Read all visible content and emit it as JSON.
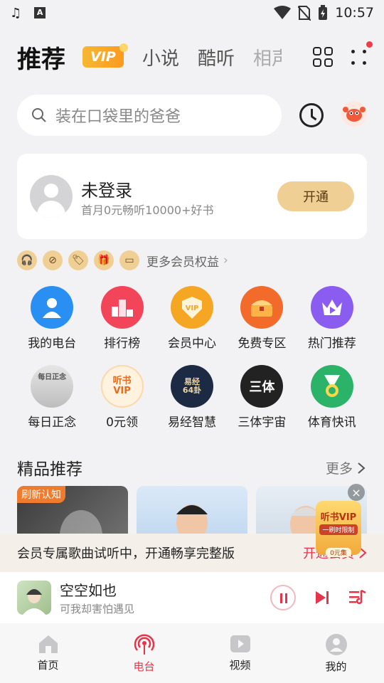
{
  "status_bar": {
    "time": "10:57"
  },
  "top_tabs": {
    "main": "推荐",
    "vip": "VIP",
    "tabs": [
      "小说",
      "酷听",
      "相声"
    ]
  },
  "search": {
    "placeholder": "装在口袋里的爸爸"
  },
  "login_card": {
    "title": "未登录",
    "subtitle": "首月0元畅听10000+好书",
    "button": "开通"
  },
  "benefits": {
    "more": "更多会员权益"
  },
  "grid": [
    {
      "label": "我的电台",
      "icon": "person-icon",
      "color": "#2a8ff2"
    },
    {
      "label": "排行榜",
      "icon": "podium-icon",
      "color": "#f2455a"
    },
    {
      "label": "会员中心",
      "icon": "vip-shield-icon",
      "color": "#f5a623",
      "text": "VIP"
    },
    {
      "label": "免费专区",
      "icon": "treasure-chest-icon",
      "color": "#f26b2a"
    },
    {
      "label": "热门推荐",
      "icon": "crown-play-icon",
      "color": "#8a5cf0"
    },
    {
      "label": "每日正念",
      "icon": "meditation-cover-icon",
      "color": "#cfcfcf",
      "text": "每日正念"
    },
    {
      "label": "0元领",
      "icon": "audiobook-vip-icon",
      "color": "#fff3e0",
      "text": "听书 VIP"
    },
    {
      "label": "易经智慧",
      "icon": "yijing-cover-icon",
      "color": "#1c2a44",
      "text": "易经 64卦"
    },
    {
      "label": "三体宇宙",
      "icon": "three-body-cover-icon",
      "color": "#222",
      "text": "三体"
    },
    {
      "label": "体育快讯",
      "icon": "medal-icon",
      "color": "#2bb36a"
    }
  ],
  "section": {
    "title": "精品推荐",
    "more": "更多"
  },
  "cards": [
    {
      "tag": "刷新认知"
    },
    {
      "tag": ""
    },
    {
      "tag": ""
    }
  ],
  "float_vip": {
    "title": "听书VIP",
    "sub": "一刷时限制",
    "price": "0元集"
  },
  "notice": {
    "text": "会员专属歌曲试听中，开通畅享完整版",
    "link": "开通会员"
  },
  "player": {
    "title": "空空如也",
    "subtitle": "可我却害怕遇见"
  },
  "bottom_nav": [
    {
      "label": "首页",
      "icon": "home-icon"
    },
    {
      "label": "电台",
      "icon": "radio-icon",
      "active": true
    },
    {
      "label": "视频",
      "icon": "video-icon"
    },
    {
      "label": "我的",
      "icon": "profile-icon"
    }
  ],
  "colors": {
    "accent": "#e8344b",
    "gold": "#efcf94",
    "background": "#f2f2f4"
  }
}
